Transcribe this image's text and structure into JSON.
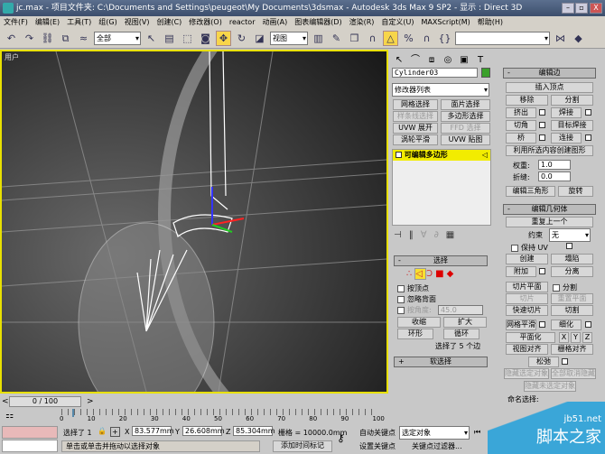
{
  "title": {
    "text": "jc.max   - 项目文件夹: C:\\Documents and Settings\\peugeot\\My Documents\\3dsmax   - Autodesk 3ds Max 9 SP2   - 显示 : Direct 3D",
    "minimize": "–",
    "maximize": "▫",
    "close": "X"
  },
  "menu": [
    "文件(F)",
    "编辑(E)",
    "工具(T)",
    "组(G)",
    "视图(V)",
    "创建(C)",
    "修改器(O)",
    "reactor",
    "动画(A)",
    "图表编辑器(D)",
    "渲染(R)",
    "自定义(U)",
    "MAXScript(M)",
    "帮助(H)"
  ],
  "toolbar": {
    "filter": "全部",
    "coord": "视图",
    "named_sel": ""
  },
  "viewport": {
    "label": "用户"
  },
  "panel": {
    "object_name": "Cylinder03",
    "object_color": "#3aa02a",
    "modifier_list": "修改器列表",
    "mod_buttons": [
      "网格选择",
      "面片选择",
      "样条线选择",
      "多边形选择",
      "UVW 展开",
      "FFD 选择",
      "涡轮平滑",
      "UVW 贴图"
    ],
    "stack_item": "可编辑多边形",
    "edit_edges": {
      "title": "编辑边",
      "insert_vertex": "插入顶点",
      "remove": "移除",
      "split": "分割",
      "extrude": "挤出",
      "weld": "焊接",
      "chamfer": "切角",
      "target_weld": "目标焊接",
      "bridge": "桥",
      "connect": "连接",
      "create_shape": "利用所选内容创建图形",
      "weight_label": "权重:",
      "weight": "1.0",
      "crease_label": "折缝:",
      "crease": "0.0",
      "edit_tri": "编辑三角形",
      "turn": "旋转"
    },
    "edit_geom": {
      "title": "编辑几何体",
      "repeat": "重复上一个",
      "constraint_label": "约束",
      "constraint": "无",
      "preserve_uv": "保持 UV",
      "create": "创建",
      "collapse": "塌陷",
      "attach": "附加",
      "detach": "分离",
      "slice_plane": "切片平面",
      "split": "分割",
      "slice": "切片",
      "reset_plane": "重置平面",
      "quickslice": "快速切片",
      "cut": "切割",
      "meshsmooth": "网格平滑",
      "tessellate": "细化",
      "make_planar": "平面化",
      "x": "X",
      "y": "Y",
      "z": "Z",
      "view_align": "视图对齐",
      "grid_align": "栅格对齐",
      "relax": "松弛",
      "hide_sel": "隐藏选定对象",
      "unhide_all": "全部取消隐藏",
      "hide_unsel": "隐藏未选定对象",
      "named_sel": "命名选择:"
    },
    "selection": {
      "title": "选择",
      "by_vertex": "按顶点",
      "ignore_back": "忽略背面",
      "by_angle": "按角度:",
      "angle": "45.0",
      "shrink": "收缩",
      "grow": "扩大",
      "ring": "环形",
      "loop": "循环",
      "status": "选择了 5 个边"
    },
    "soft_sel": {
      "title": "软选择"
    }
  },
  "timeline": {
    "frame": "0 / 100",
    "ticks": [
      "0",
      "10",
      "20",
      "30",
      "40",
      "50",
      "60",
      "70",
      "80",
      "90",
      "100"
    ]
  },
  "status": {
    "selected": "选择了 1",
    "x_label": "X",
    "x": "83.577mm",
    "y_label": "Y",
    "y": "26.608mm",
    "z_label": "Z",
    "z": "85.304mm",
    "grid": "栅格 = 10000.0mm",
    "prompt": "单击或单击并拖动以选择对象",
    "add_tag": "添加时间标记",
    "auto_key": "自动关键点",
    "key_mode": "选定对象",
    "set_key": "设置关键点",
    "key_filters": "关键点过滤器..."
  },
  "watermark": {
    "site": "jb51.net",
    "name": "脚本之家"
  }
}
